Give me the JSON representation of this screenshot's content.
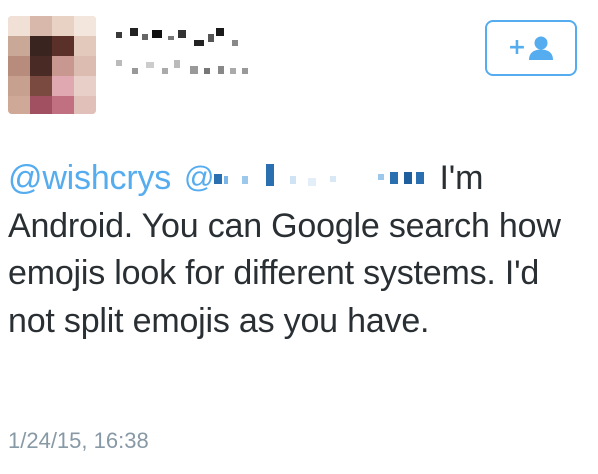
{
  "tweet": {
    "mention": "@wishcrys",
    "text_after_redaction": " I'm Android. You can Google search how emojis look for different systems. I'd not split emojis as you have.",
    "timestamp": "1/24/15, 16:38"
  },
  "follow_button": {
    "icon": "add-user-icon",
    "plus_symbol": "+"
  },
  "colors": {
    "accent": "#55acee",
    "text": "#292f33",
    "muted": "#8899a6"
  }
}
